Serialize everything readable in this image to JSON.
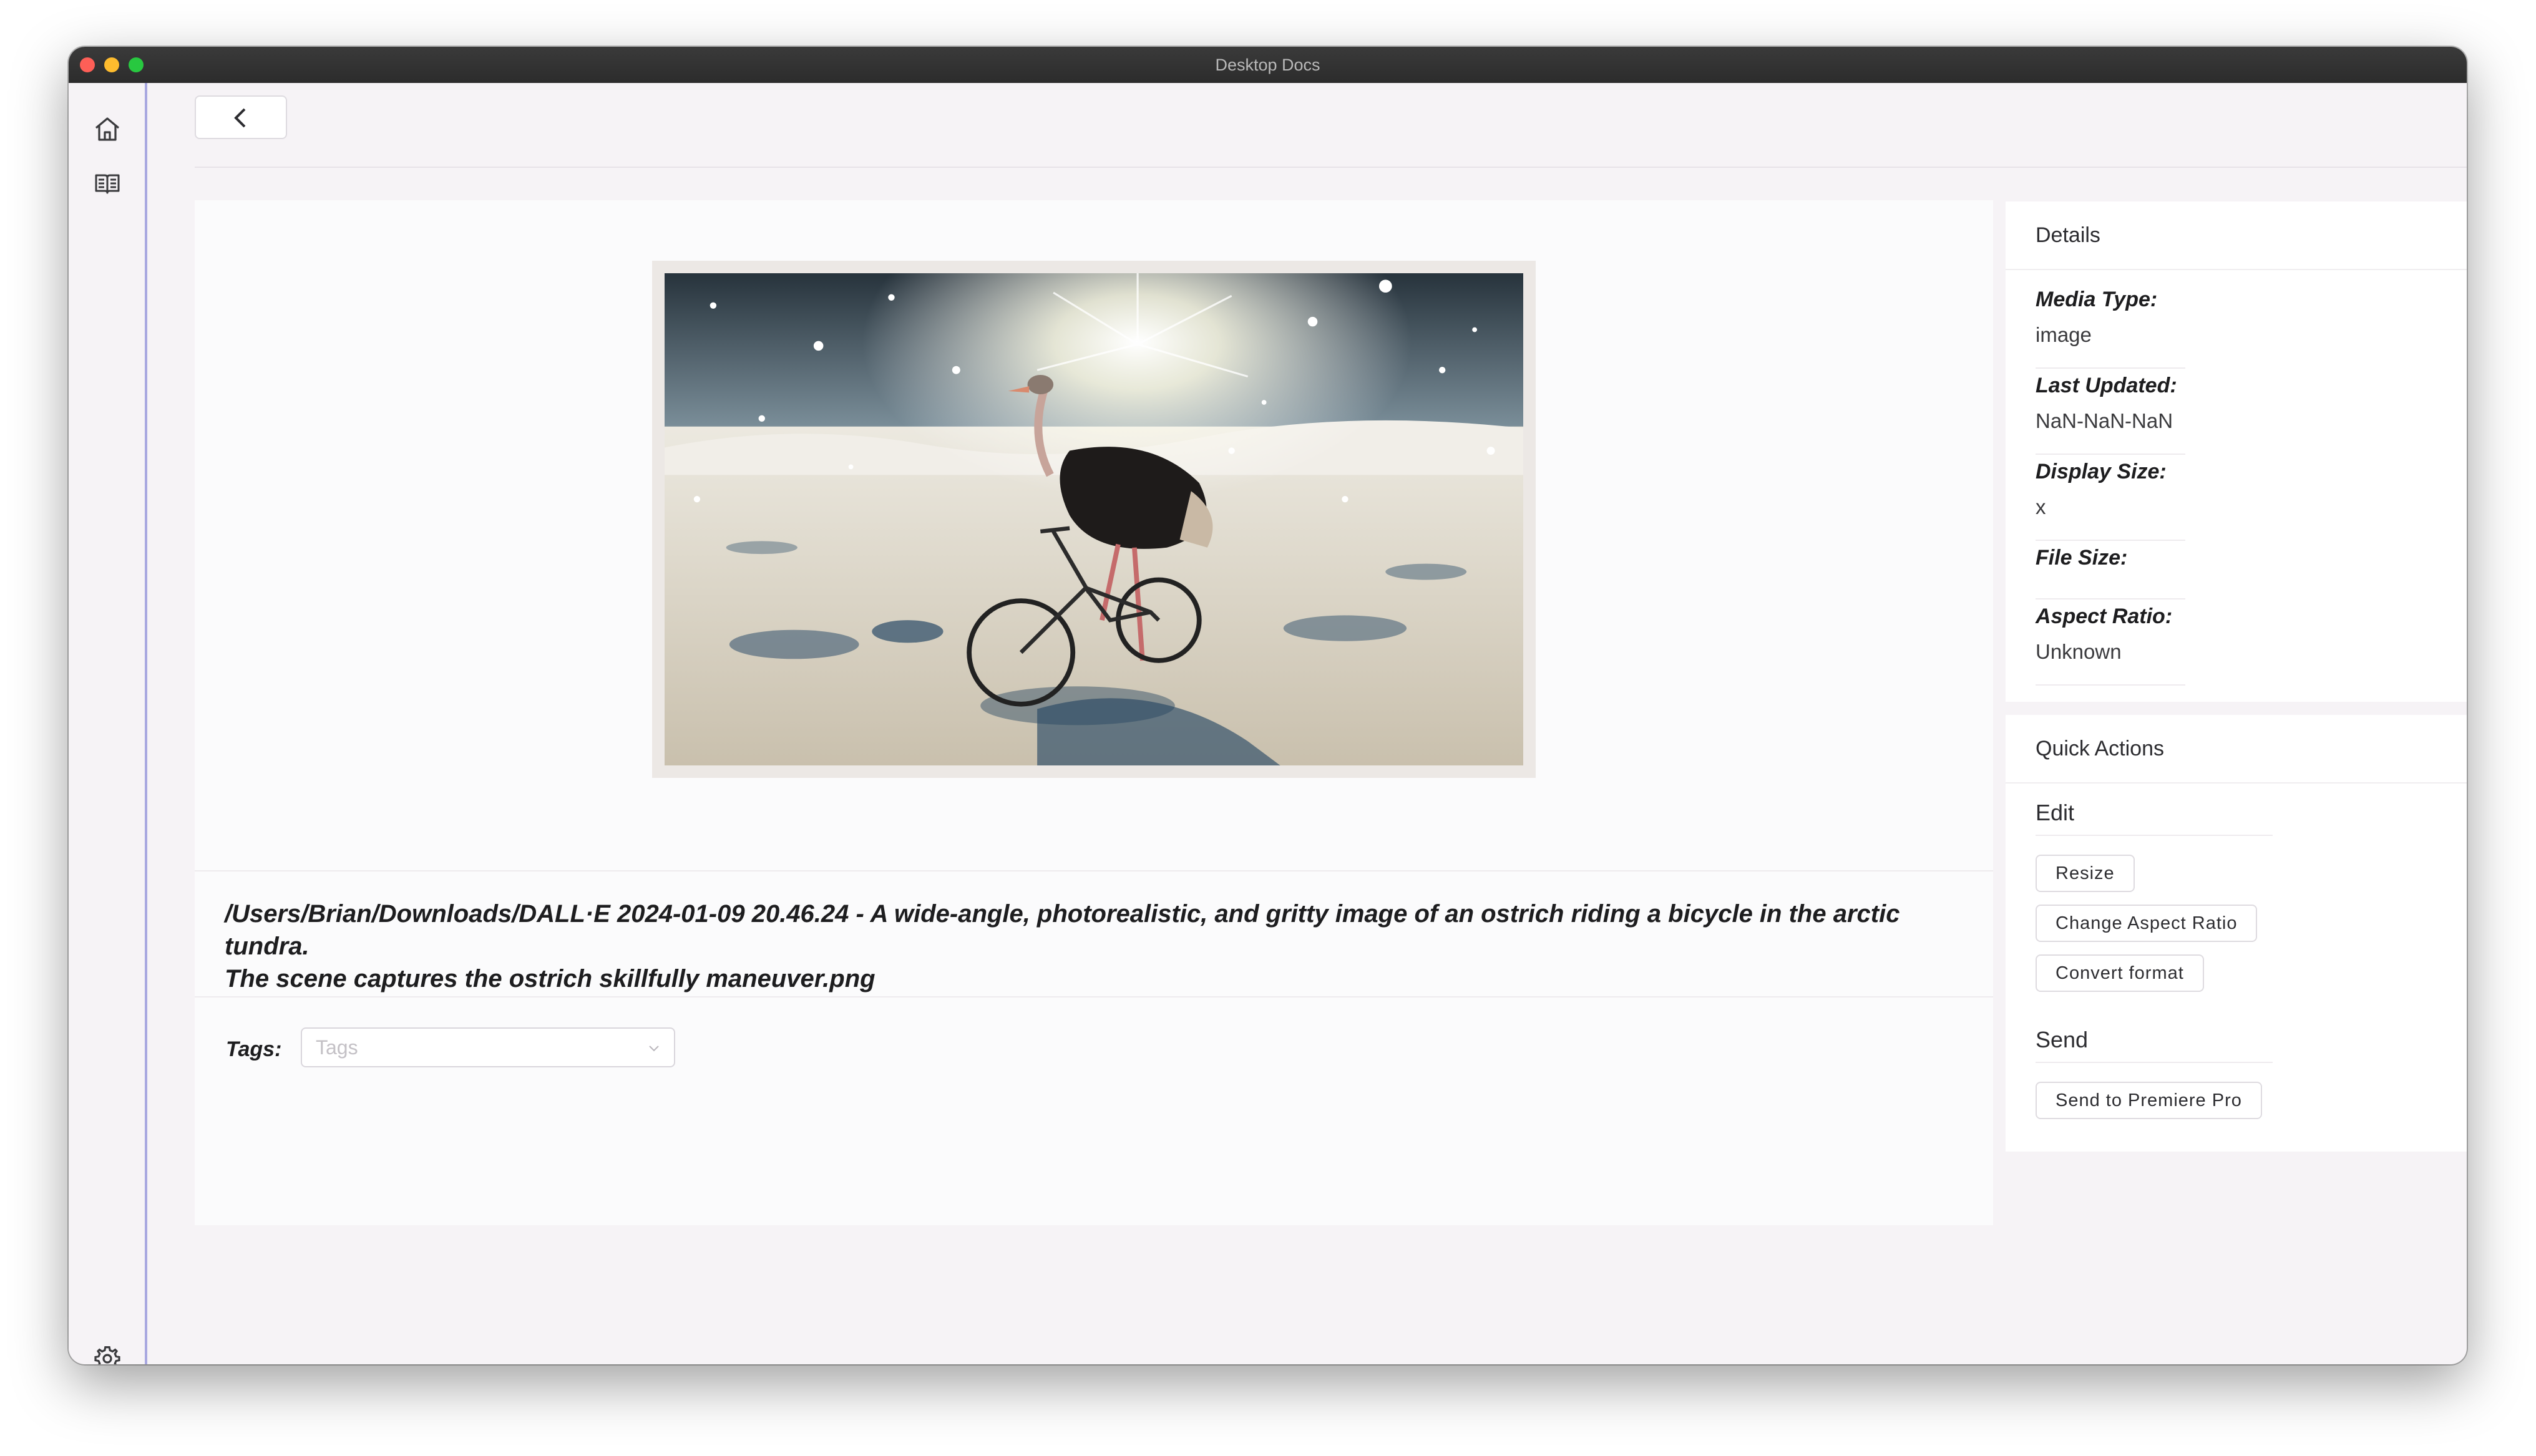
{
  "window": {
    "title": "Desktop Docs"
  },
  "sidebar": {
    "items": [
      {
        "icon": "home-icon"
      },
      {
        "icon": "book-icon"
      }
    ],
    "footer_icon": "gear-icon"
  },
  "media": {
    "image_description_icon": "ostrich-bicycle-image",
    "file_path": "/Users/Brian/Downloads/DALL·E 2024-01-09 20.46.24 - A wide-angle, photorealistic, and gritty image of an ostrich riding a bicycle in the arctic tundra.\nThe scene captures the ostrich skillfully maneuver.png"
  },
  "tags": {
    "label": "Tags:",
    "placeholder": "Tags"
  },
  "details": {
    "title": "Details",
    "media_type_label": "Media Type:",
    "media_type_value": "image",
    "last_updated_label": "Last Updated:",
    "last_updated_value": "NaN-NaN-NaN",
    "display_size_label": "Display Size:",
    "display_size_value": "x",
    "file_size_label": "File Size:",
    "file_size_value": "",
    "aspect_ratio_label": "Aspect Ratio:",
    "aspect_ratio_value": "Unknown"
  },
  "quick_actions": {
    "title": "Quick Actions",
    "edit_title": "Edit",
    "resize_label": "Resize",
    "change_aspect_label": "Change Aspect Ratio",
    "convert_label": "Convert format",
    "send_title": "Send",
    "send_premiere_label": "Send to Premiere Pro"
  },
  "colors": {
    "accent_border": "#a9a8e0",
    "titlebar": "#2c2c2c",
    "background": "#f6f3f6"
  }
}
